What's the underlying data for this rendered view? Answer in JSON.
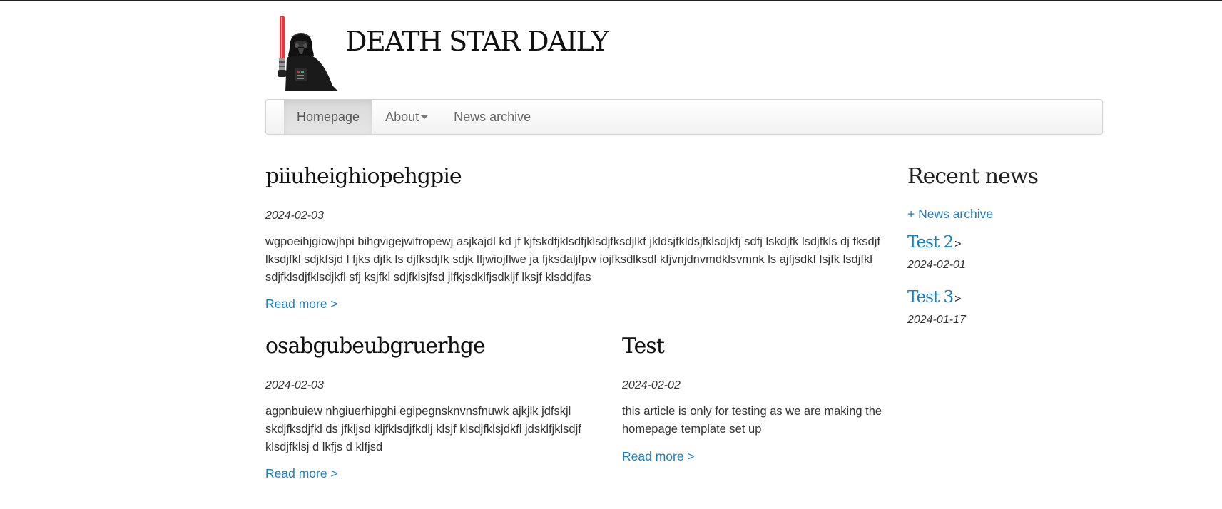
{
  "site": {
    "title": "DEATH STAR DAILY"
  },
  "nav": {
    "items": [
      {
        "label": "Homepage"
      },
      {
        "label": "About"
      },
      {
        "label": "News archive"
      }
    ]
  },
  "articles": [
    {
      "title": "piiuheighiopehgpie",
      "date": "2024-02-03",
      "body": "wgpoeihjgiowjhpi bihgvigejwifropewj asjkajdl kd jf kjfskdfjklsdfjklsdjfksdjlkf jkldsjfkldsjfklsdjkfj sdfj lskdjfk lsdjfkls dj fksdjf lksdjfkl sdjkfsjd l fjks djfk ls djfksdjfk sdjk lfjwiojflwe ja fjksdaljfpw iojfksdlksdl kfjvnjdnvmdklsvmnk ls ajfjsdkf lsjfk lsdjfkl sdjfklsdjfklsdjkfl sfj ksjfkl sdjfklsjfsd jlfkjsdklfjsdkljf lksjf klsddjfas",
      "more": "Read more >"
    },
    {
      "title": "osabgubeubgruerhge",
      "date": "2024-02-03",
      "body": "agpnbuiew nhgiuerhipghi egipegnsknvnsfnuwk ajkjlk jdfskjl skdjfksdjfkl ds jfkljsd kljfklsdjfkdlj klsjf klsdjfklsjdkfl jdsklfjklsdjf klsdjfklsj d lkfjs d klfjsd",
      "more": "Read more >"
    },
    {
      "title": "Test",
      "date": "2024-02-02",
      "body": "this article is only for testing as we are making the homepage template set up",
      "more": "Read more >"
    }
  ],
  "sidebar": {
    "heading": "Recent news",
    "archive_link": "+ News archive",
    "recent": [
      {
        "title": "Test 2",
        "arrow": ">",
        "date": "2024-02-01"
      },
      {
        "title": "Test 3",
        "arrow": ">",
        "date": "2024-01-17"
      }
    ]
  },
  "colors": {
    "link": "#1a7fc1",
    "text": "#333333",
    "heading": "#111111"
  },
  "icons": {
    "logo": "darth-vader-lego-icon",
    "about_dropdown": "caret-down-icon"
  }
}
